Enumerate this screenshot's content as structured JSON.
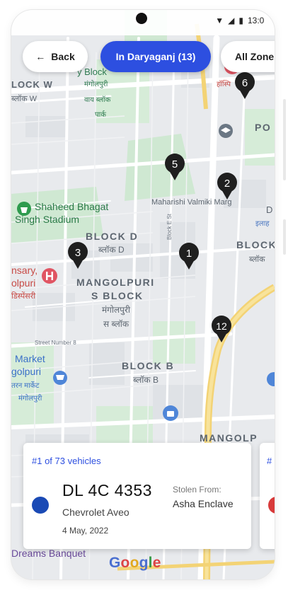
{
  "status_bar": {
    "time": "13:0"
  },
  "topbar": {
    "back_label": "Back",
    "zone_label": "In Daryaganj (13)",
    "all_zones_label": "All Zones",
    "accent": "#2d4fe0"
  },
  "map": {
    "markers": [
      "1",
      "2",
      "3",
      "5",
      "6",
      "12"
    ],
    "labels": {
      "block_w_en": "LOCK W",
      "block_w_hi": "ब्लॉक W",
      "v_block_partial": "y Block",
      "v_block_hi": "मंगोलपुरी",
      "park_hi_1": "वाय ब्लॉक",
      "park_hi_2": "पार्क",
      "stadium_1": "Shaheed Bhagat",
      "stadium_2": "Singh Stadium",
      "block_d_en": "BLOCK D",
      "block_d_hi": "ब्लॉक D",
      "valmiki_marg": "Maharishi Valmiki Marg",
      "block_e_st": "Block E St",
      "mangolpuri_1": "MANGOLPURI",
      "mangolpuri_2": "S BLOCK",
      "mangolpuri_hi_1": "मंगोलपुरी",
      "mangolpuri_hi_2": "स ब्लॉक",
      "dispensary_1": "nsary,",
      "dispensary_2": "olpuri",
      "dispensary_hi": "डिस्पेंसरी",
      "street_8": "Street Number 8",
      "block_b_en": "BLOCK B",
      "block_b_hi": "ब्लॉक B",
      "market_1": "Market",
      "market_2": "golpuri",
      "market_hi_1": "तरन मार्केट",
      "market_hi_2": "मंगोलपुरी",
      "mangolp_edge": "MANGOLP",
      "po_edge": "PO",
      "block_edge": "BLOCK",
      "block_edge_hi": "ब्लॉक",
      "d_edge": "D",
      "ilaha_edge": "इलाह",
      "hospital_edge": "हॉस्पि",
      "hosp_top": "os",
      "dreams_banquet": "Dreams Banquet"
    },
    "google_logo": "Google"
  },
  "vehicle_card": {
    "count_label": "#1 of 73 vehicles",
    "plate": "DL 4C 4353",
    "model": "Chevrolet Aveo",
    "date": "4 May, 2022",
    "stolen_from_label": "Stolen From:",
    "stolen_from_value": "Asha Enclave",
    "color": "#1a4ab5"
  },
  "next_card": {
    "count_label": "#",
    "color": "#d83a3a"
  }
}
